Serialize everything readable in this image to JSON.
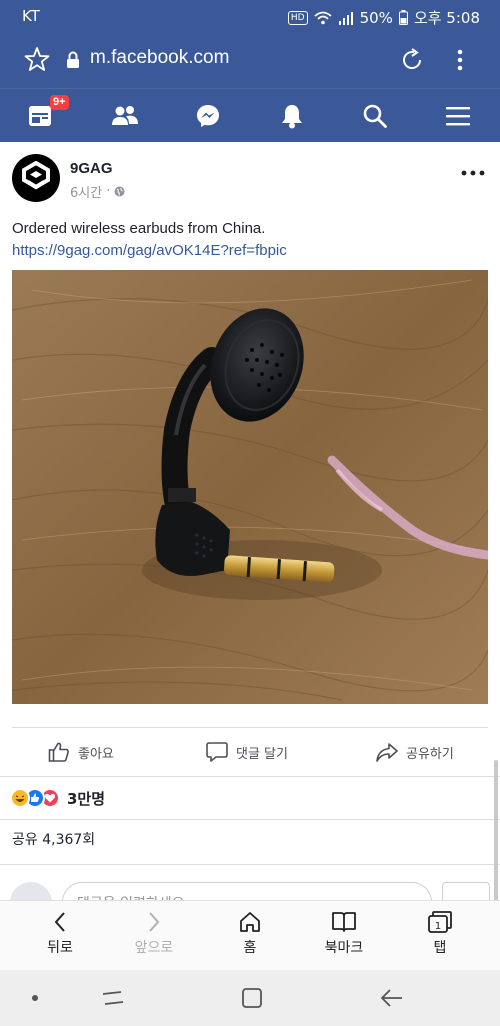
{
  "status_bar": {
    "carrier": "KT",
    "hd": "HD",
    "battery": "50%",
    "time": "오후 5:08"
  },
  "browser": {
    "url": "m.facebook.com"
  },
  "fb_nav": {
    "notifications_badge": "9+",
    "items": [
      "home-icon",
      "friends-icon",
      "messenger-icon",
      "bell-icon",
      "search-icon",
      "menu-icon"
    ]
  },
  "post": {
    "author": "9GAG",
    "time": "6시간",
    "separator": "·",
    "text": "Ordered wireless earbuds from China.",
    "link": "https://9gag.com/gag/avOK14E?ref=fbpic",
    "actions": {
      "like": "좋아요",
      "comment": "댓글 달기",
      "share": "공유하기"
    },
    "reactions_count": "3만명",
    "shares": "공유 4,367회",
    "comment_placeholder": "댓글을 입력하세요..."
  },
  "browser_toolbar": {
    "back": "뒤로",
    "forward": "앞으로",
    "home": "홈",
    "bookmarks": "북마크",
    "tabs": "탭",
    "tabs_count": "1"
  },
  "colors": {
    "facebook_blue": "#3b5998",
    "link": "#365899",
    "badge_red": "#fa3e3e"
  }
}
